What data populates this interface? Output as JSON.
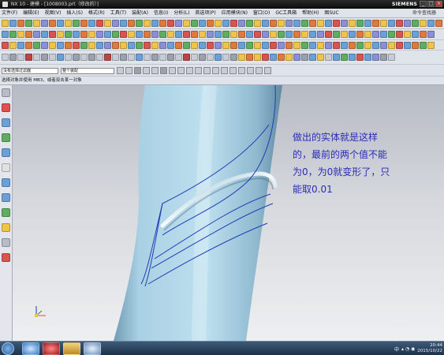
{
  "window": {
    "title": "NX 10 - 建模 - [1008003.prt（修改的）]",
    "brand": "SIEMENS"
  },
  "menu": {
    "items": [
      "文件(F)",
      "编辑(E)",
      "视图(V)",
      "插入(S)",
      "格式(R)",
      "工具(T)",
      "装配(A)",
      "信息(I)",
      "分析(L)",
      "首选项(P)",
      "应用模块(N)",
      "窗口(O)",
      "GC工具箱",
      "帮助(H)",
      "图SUC"
    ],
    "help_search": "命令查找器"
  },
  "toolbar": {
    "filter_select": "没有选择过滤器",
    "scope_select": "整个装配"
  },
  "status": {
    "prompt": "选择对象并使用 MB3，或者双击某一对象"
  },
  "annotation": {
    "line1": "做出的实体就是这样",
    "line2": "的，最前的两个值不能",
    "line3": "为0，为0就变形了，只",
    "line4": "能取0.01"
  },
  "taskbar": {
    "lang": "中",
    "time": "20:44",
    "date": "2015/10/22"
  },
  "colors": {
    "shape": "#9ec7dc",
    "curve": "#1e3cb4",
    "annotation": "#2b2bb8"
  }
}
